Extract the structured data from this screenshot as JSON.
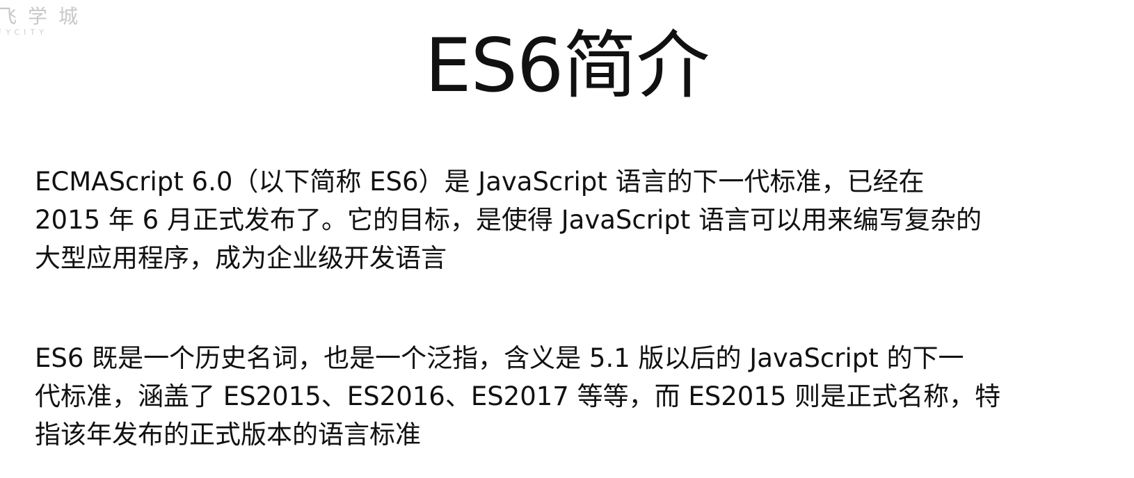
{
  "watermark": {
    "chinese": "飞学城",
    "english": "FYCITY"
  },
  "slide": {
    "title": "ES6简介",
    "paragraphs": [
      {
        "lines": [
          "ECMAScript 6.0（以下简称 ES6）是 JavaScript 语言的下一代标准，已经在",
          "2015 年 6 月正式发布了。它的目标，是使得 JavaScript 语言可以用来编写复杂的",
          "大型应用程序，成为企业级开发语言"
        ]
      },
      {
        "lines": [
          "ES6 既是一个历史名词，也是一个泛指，含义是 5.1 版以后的 JavaScript 的下一",
          "代标准，涵盖了 ES2015、ES2016、ES2017 等等，而 ES2015 则是正式名称，特",
          "指该年发布的正式版本的语言标准"
        ]
      }
    ]
  }
}
